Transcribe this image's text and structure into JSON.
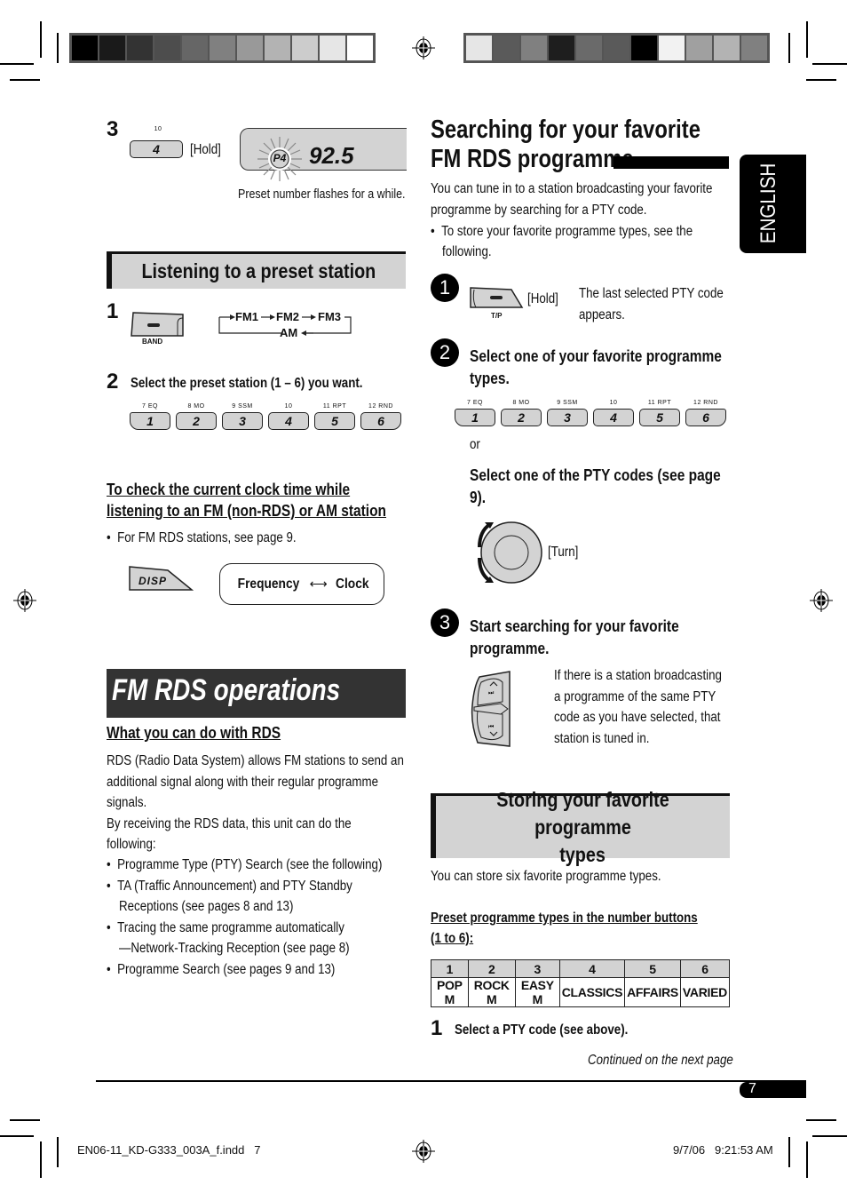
{
  "print_marks": {
    "color_bar_left": [
      "#000000",
      "#1a1a1a",
      "#333333",
      "#4d4d4d",
      "#666666",
      "#808080",
      "#999999",
      "#b3b3b3",
      "#cccccc",
      "#e6e6e6",
      "#ffffff"
    ],
    "color_bar_right": [
      "#e6e6e6",
      "#5a5a5a",
      "#808080",
      "#1e1e1e",
      "#6a6a6a",
      "#5a5a5a",
      "#000000",
      "#f2f2f2",
      "#a0a0a0",
      "#b3b3b3",
      "#808080"
    ]
  },
  "left": {
    "step3": {
      "num": "3",
      "key_top": "10",
      "key_face": "4",
      "hold": "[Hold]",
      "display_preset": "P4",
      "display_freq": "92.5",
      "caption": "Preset number flashes for a while."
    },
    "preset_section": {
      "title": "Listening to a preset station",
      "step1_num": "1",
      "band_label": "BAND",
      "cycle": [
        "FM1",
        "FM2",
        "FM3",
        "AM"
      ],
      "step2_num": "2",
      "step2_text": "Select the preset station (1 – 6) you want."
    },
    "preset_keys": [
      {
        "top": "7 EQ",
        "face": "1"
      },
      {
        "top": "8 MO",
        "face": "2"
      },
      {
        "top": "9 SSM",
        "face": "3"
      },
      {
        "top": "10",
        "face": "4"
      },
      {
        "top": "11 RPT",
        "face": "5"
      },
      {
        "top": "12 RND",
        "face": "6"
      }
    ],
    "clock": {
      "heading_line1": "To check the current clock time while",
      "heading_line2": "listening to an FM (non-RDS) or AM station",
      "bullet": "For FM RDS stations, see page 9.",
      "disp_key": "DISP",
      "toggle_left": "Frequency",
      "toggle_right": "Clock"
    },
    "rds": {
      "banner": "FM RDS operations",
      "subheading": "What you can do with RDS",
      "para_lines": [
        "RDS (Radio Data System) allows FM stations to send an",
        "additional signal along with their regular programme",
        "signals.",
        "By receiving the RDS data, this unit can do the",
        "following:"
      ],
      "bullets": [
        [
          "Programme Type (PTY) Search (see the following)"
        ],
        [
          "TA (Traffic Announcement) and PTY Standby",
          "Receptions (see pages 8 and 13)"
        ],
        [
          "Tracing the same programme automatically",
          "—Network-Tracking Reception (see page 8)"
        ],
        [
          "Programme Search (see pages 9 and 13)"
        ]
      ]
    }
  },
  "right": {
    "title_line1": "Searching for your favorite",
    "title_line2": "FM RDS programme",
    "intro_lines": [
      "You can tune in to a station broadcasting your favorite",
      "programme by searching for a PTY code."
    ],
    "intro_bullet": [
      "To store your favorite programme types, see the",
      "following."
    ],
    "step1": {
      "num": "1",
      "key_label": "T/P",
      "hold": "[Hold]",
      "desc_lines": [
        "The last selected PTY code",
        "appears."
      ]
    },
    "step2": {
      "num": "2",
      "text_lines": [
        "Select one of your favorite programme",
        "types."
      ],
      "or": "or",
      "alt_lines": [
        "Select one of the PTY codes (see page",
        "9)."
      ],
      "turn": "[Turn]"
    },
    "step3": {
      "num": "3",
      "text_lines": [
        "Start searching for your favorite",
        "programme."
      ],
      "desc_lines": [
        "If there is a station broadcasting",
        "a programme of the same PTY",
        "code as you have selected, that",
        "station is tuned in."
      ]
    },
    "storing": {
      "title_line1": "Storing your favorite programme",
      "title_line2": "types",
      "intro": "You can store six favorite programme types.",
      "table_heading_line1": "Preset programme types in the number buttons",
      "table_heading_line2": "(1 to 6):",
      "table": {
        "numbers": [
          "1",
          "2",
          "3",
          "4",
          "5",
          "6"
        ],
        "types": [
          "POP M",
          "ROCK M",
          "EASY M",
          "CLASSICS",
          "AFFAIRS",
          "VARIED"
        ]
      },
      "step1_num": "1",
      "step1_text": "Select a PTY code (see above).",
      "continued": "Continued on the next page"
    }
  },
  "side_tab": "ENGLISH",
  "page_number": "7",
  "footer": {
    "file": "EN06-11_KD-G333_003A_f.indd   7",
    "timestamp": "9/7/06   9:21:53 AM"
  }
}
